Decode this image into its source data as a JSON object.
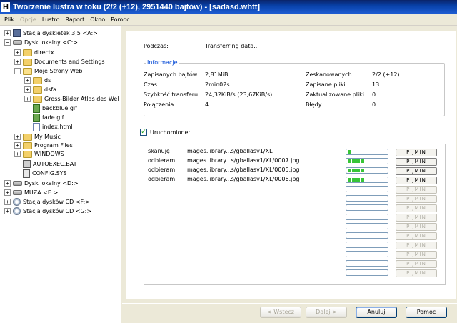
{
  "window": {
    "title": "Tworzenie lustra w toku (2/2 (+12), 2951440 bajtów) - [sadasd.whtt]"
  },
  "menu": [
    {
      "label": "Plik",
      "disabled": false
    },
    {
      "label": "Opcje",
      "disabled": true
    },
    {
      "label": "Lustro",
      "disabled": false
    },
    {
      "label": "Raport",
      "disabled": false
    },
    {
      "label": "Okno",
      "disabled": false
    },
    {
      "label": "Pomoc",
      "disabled": false
    }
  ],
  "tree": [
    {
      "label": "Stacja dyskietek 3,5 <A:>",
      "icon": "floppy-icon",
      "exp": "+"
    },
    {
      "label": "Dysk lokalny <C:>",
      "icon": "drive-icon",
      "exp": "-"
    },
    {
      "label": "directx",
      "icon": "folder-icon",
      "exp": "+"
    },
    {
      "label": "Documents and Settings",
      "icon": "folder-icon",
      "exp": "+"
    },
    {
      "label": "Moje Strony Web",
      "icon": "folder-open-icon",
      "exp": "-"
    },
    {
      "label": "ds",
      "icon": "folder-icon",
      "exp": "+"
    },
    {
      "label": "dsfa",
      "icon": "folder-icon",
      "exp": "+"
    },
    {
      "label": "Gross-Bilder Atlas des Wel",
      "icon": "folder-icon",
      "exp": "+"
    },
    {
      "label": "backblue.gif",
      "icon": "gif-file-icon",
      "exp": ""
    },
    {
      "label": "fade.gif",
      "icon": "gif-file-icon",
      "exp": ""
    },
    {
      "label": "index.html",
      "icon": "html-file-icon",
      "exp": ""
    },
    {
      "label": "My Music",
      "icon": "folder-icon",
      "exp": "+"
    },
    {
      "label": "Program Files",
      "icon": "folder-icon",
      "exp": "+"
    },
    {
      "label": "WINDOWS",
      "icon": "folder-icon",
      "exp": "+"
    },
    {
      "label": "AUTOEXEC.BAT",
      "icon": "bat-file-icon",
      "exp": ""
    },
    {
      "label": "CONFIG.SYS",
      "icon": "sys-file-icon",
      "exp": ""
    },
    {
      "label": "Dysk lokalny <D:>",
      "icon": "drive-icon",
      "exp": "+"
    },
    {
      "label": "MUZA <E:>",
      "icon": "drive-icon",
      "exp": "+"
    },
    {
      "label": "Stacja dysków CD <F:>",
      "icon": "cd-icon",
      "exp": "+"
    },
    {
      "label": "Stacja dysków CD <G:>",
      "icon": "cd-icon",
      "exp": "+"
    }
  ],
  "status": {
    "label": "Podczas:",
    "value": "Transferring data.."
  },
  "info": {
    "title": "Informacje",
    "left": [
      {
        "label": "Zapisanych bajtów:",
        "value": "2,81MiB"
      },
      {
        "label": "Czas:",
        "value": "2min02s"
      },
      {
        "label": "Szybkość transferu:",
        "value": "24,32KiB/s (23,67KiB/s)"
      },
      {
        "label": "Połączenia:",
        "value": "4"
      }
    ],
    "right": [
      {
        "label": "Zeskanowanych",
        "value": "2/2 (+12)"
      },
      {
        "label": "Zapisane pliki:",
        "value": "13"
      },
      {
        "label": "Zaktualizowane pliki:",
        "value": "0"
      },
      {
        "label": "Błędy:",
        "value": "0"
      }
    ]
  },
  "running": {
    "label": "Uruchomione:",
    "checked": true
  },
  "transfers": [
    {
      "action": "skanuję",
      "url": "mages.library...s/gballasv1/XL",
      "progress": 0.1,
      "button": "PIJMIN",
      "active": true
    },
    {
      "action": "odbieram",
      "url": "mages.library...s/gballasv1/XL/0007.jpg",
      "progress": 0.4,
      "button": "PIJMIN",
      "active": true
    },
    {
      "action": "odbieram",
      "url": "mages.library...s/gballasv1/XL/0005.jpg",
      "progress": 0.4,
      "button": "PIJMIN",
      "active": true
    },
    {
      "action": "odbieram",
      "url": "mages.library...s/gballasv1/XL/0006.jpg",
      "progress": 0.4,
      "button": "PIJMIN",
      "active": true
    },
    {
      "action": "",
      "url": "",
      "progress": 0,
      "button": "PIJMIN",
      "active": false
    },
    {
      "action": "",
      "url": "",
      "progress": 0,
      "button": "PIJMIN",
      "active": false
    },
    {
      "action": "",
      "url": "",
      "progress": 0,
      "button": "PIJMIN",
      "active": false
    },
    {
      "action": "",
      "url": "",
      "progress": 0,
      "button": "PIJMIN",
      "active": false
    },
    {
      "action": "",
      "url": "",
      "progress": 0,
      "button": "PIJMIN",
      "active": false
    },
    {
      "action": "",
      "url": "",
      "progress": 0,
      "button": "PIJMIN",
      "active": false
    },
    {
      "action": "",
      "url": "",
      "progress": 0,
      "button": "PIJMIN",
      "active": false
    },
    {
      "action": "",
      "url": "",
      "progress": 0,
      "button": "PIJMIN",
      "active": false
    },
    {
      "action": "",
      "url": "",
      "progress": 0,
      "button": "PIJMIN",
      "active": false
    },
    {
      "action": "",
      "url": "",
      "progress": 0,
      "button": "PIJMIN",
      "active": false
    }
  ],
  "buttons": {
    "back": "< Wstecz",
    "next": "Dalej >",
    "cancel": "Anuluj",
    "help": "Pomoc"
  }
}
